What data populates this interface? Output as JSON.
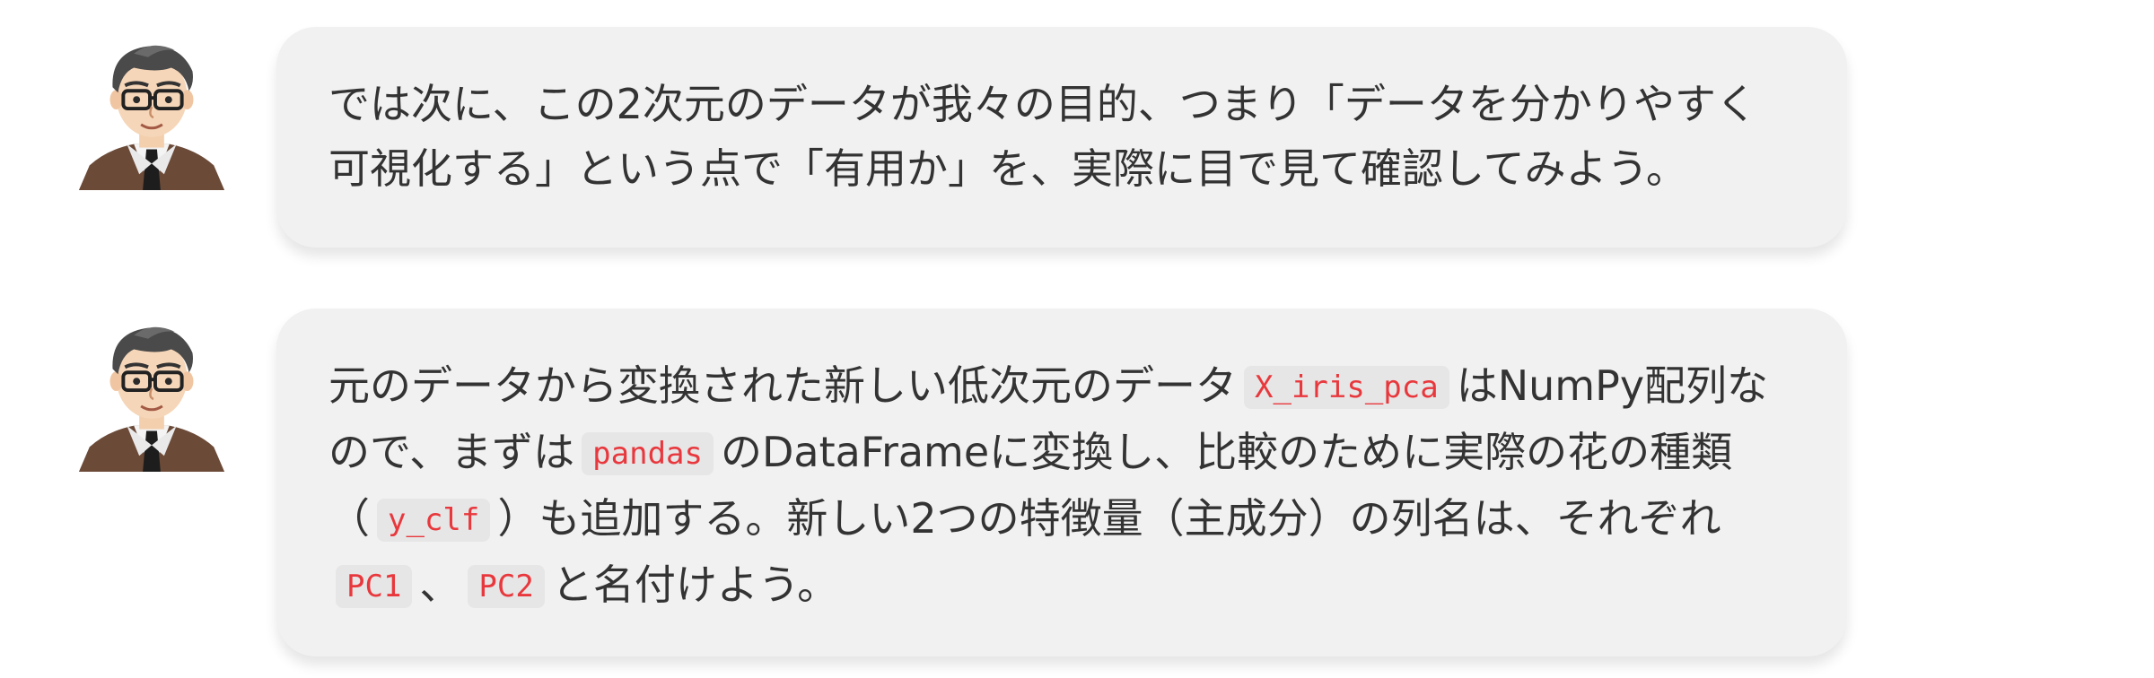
{
  "messages": [
    {
      "segments": [
        {
          "type": "text",
          "value": "では次に、この2次元のデータが我々の目的、つまり「データを分かりやすく可視化する」という点で「有用か」を、実際に目で見て確認してみよう。"
        }
      ]
    },
    {
      "segments": [
        {
          "type": "text",
          "value": "元のデータから変換された新しい低次元のデータ"
        },
        {
          "type": "code",
          "value": "X_iris_pca"
        },
        {
          "type": "text",
          "value": "はNumPy配列なので、まずは"
        },
        {
          "type": "code",
          "value": "pandas"
        },
        {
          "type": "text",
          "value": "のDataFrameに変換し、比較のために実際の花の種類（"
        },
        {
          "type": "code",
          "value": "y_clf"
        },
        {
          "type": "text",
          "value": "）も追加する。新しい2つの特徴量（主成分）の列名は、それぞれ"
        },
        {
          "type": "code",
          "value": "PC1"
        },
        {
          "type": "text",
          "value": "、"
        },
        {
          "type": "code",
          "value": "PC2"
        },
        {
          "type": "text",
          "value": "と名付けよう。"
        }
      ]
    }
  ],
  "colors": {
    "bubble_background": "#f1f1f1",
    "code_text": "#e8383d",
    "code_background": "#e6e6e6",
    "body_text": "#333333"
  },
  "icons": {
    "avatar": "teacher-avatar-icon"
  }
}
